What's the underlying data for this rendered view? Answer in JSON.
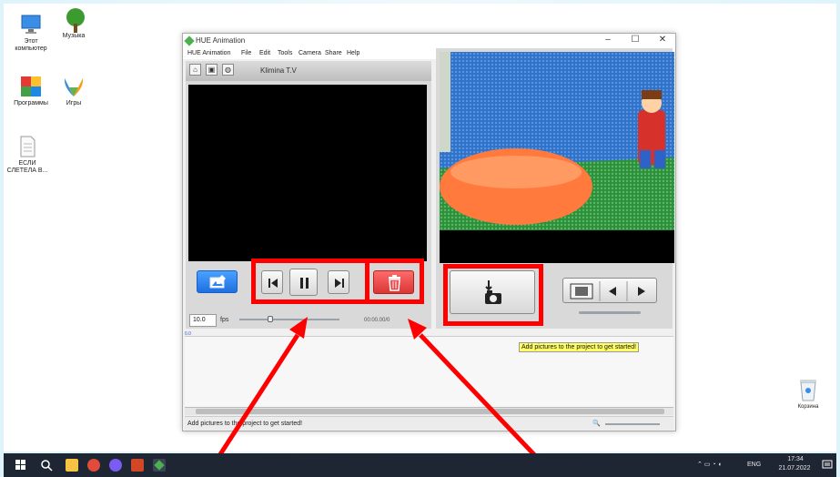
{
  "desktop_icons": [
    {
      "label": "Этот компьютер",
      "icon": "computer-icon"
    },
    {
      "label": "Музыка",
      "icon": "tree-icon"
    },
    {
      "label": "Программы",
      "icon": "programs-icon"
    },
    {
      "label": "Игры",
      "icon": "butterfly-icon"
    },
    {
      "label": "ЕСЛИ СЛЕТЕЛА В...",
      "icon": "document-icon"
    },
    {
      "label": "Корзина",
      "icon": "recycle-bin-icon"
    }
  ],
  "window": {
    "title": "HUE Animation",
    "controls": {
      "minimize": "–",
      "maximize": "☐",
      "close": "✕"
    },
    "menu": [
      "HUE Animation",
      "File",
      "Edit",
      "Tools",
      "Camera",
      "Share",
      "Help"
    ],
    "project_name": "Klimina T.V"
  },
  "playback": {
    "fps_value": "10.0",
    "fps_label": "fps",
    "time": "00:00.00/0",
    "frame_marker": "0.0"
  },
  "timeline": {
    "hint": "Add pictures to the project to get started!"
  },
  "statusbar": {
    "text": "Add pictures to the project to get started!"
  },
  "taskbar": {
    "lang": "ENG",
    "time": "17:34",
    "date": "21.07.2022"
  },
  "colors": {
    "highlight": "#ff0000",
    "delete": "#e04444",
    "import": "#2e86f0"
  }
}
